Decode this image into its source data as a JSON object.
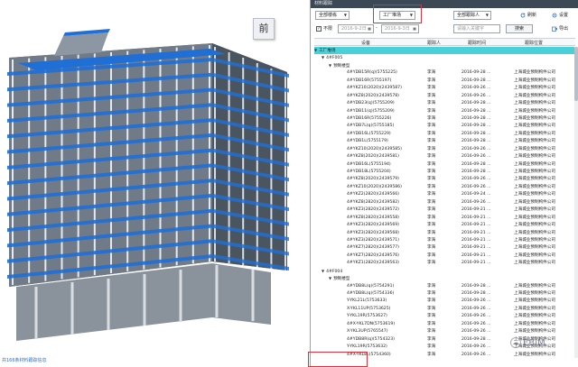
{
  "viewport": {
    "viewcube_label": "前"
  },
  "panel": {
    "title": "材料跟踪",
    "filters": {
      "building_select": "全部楼栋",
      "location_select": "工厂堆场",
      "user_select": "全部跟踪人",
      "refresh_label": "刷新",
      "settings_label": "设置",
      "noframe_label": "不限",
      "date_from_placeholder": "2016-9-2日",
      "date_to_placeholder": "2016-9-3日",
      "keyword_placeholder": "请输入关键字",
      "search_label": "搜索",
      "export_label": "导出"
    },
    "columns": {
      "device": "设备",
      "user": "跟踪人",
      "time": "跟踪时间",
      "location": "跟踪位置"
    },
    "rows": [
      {
        "level": 0,
        "device": "工厂堆场",
        "user": "",
        "time": "",
        "loc": "",
        "hl": true
      },
      {
        "level": 1,
        "device": "4#F005",
        "user": "",
        "time": "",
        "loc": ""
      },
      {
        "level": 2,
        "device": "预制楼型",
        "user": "",
        "time": "",
        "loc": ""
      },
      {
        "level": 3,
        "device": "4#YDB15R(q)(5755225)",
        "user": "李海",
        "time": "2016-09-28 ...",
        "loc": "上海城业预制构件公司"
      },
      {
        "level": 3,
        "device": "4#YDB16R(5755197)",
        "user": "李海",
        "time": "2016-09-28 ...",
        "loc": "上海城业预制构件公司"
      },
      {
        "level": 3,
        "device": "4#YKZ10(2020)(2439587)",
        "user": "李海",
        "time": "2016-09-26 ...",
        "loc": "上海城业预制构件公司"
      },
      {
        "level": 3,
        "device": "4#YKZ8(2020)(2439578)",
        "user": "李海",
        "time": "2016-09-26 ...",
        "loc": "上海城业预制构件公司"
      },
      {
        "level": 3,
        "device": "4#YDB23(q)(5755209)",
        "user": "李海",
        "time": "2016-09-28 ...",
        "loc": "上海城业预制构件公司"
      },
      {
        "level": 3,
        "device": "4#YDB11(q)(5755209)",
        "user": "李海",
        "time": "2016-09-28 ...",
        "loc": "上海城业预制构件公司"
      },
      {
        "level": 3,
        "device": "4#YDB16R(5755226)",
        "user": "李海",
        "time": "2016-09-28 ...",
        "loc": "上海城业预制构件公司"
      },
      {
        "level": 3,
        "device": "4#YDB7L(q)(5755185)",
        "user": "李海",
        "time": "2016-09-28 ...",
        "loc": "上海城业预制构件公司"
      },
      {
        "level": 3,
        "device": "4#YDB16L(5755229)",
        "user": "李海",
        "time": "2016-09-28 ...",
        "loc": "上海城业预制构件公司"
      },
      {
        "level": 3,
        "device": "4#YDB1L(5755179)",
        "user": "李海",
        "time": "2016-09-28 ...",
        "loc": "上海城业预制构件公司"
      },
      {
        "level": 3,
        "device": "4#YKZ10(2020)(2439585)",
        "user": "李海",
        "time": "2016-09-26 ...",
        "loc": "上海城业预制构件公司"
      },
      {
        "level": 3,
        "device": "4#YKZ8(2020)(2439581)",
        "user": "李海",
        "time": "2016-09-26 ...",
        "loc": "上海城业预制构件公司"
      },
      {
        "level": 3,
        "device": "4#YDB16L(5755194)",
        "user": "李海",
        "time": "2016-09-28 ...",
        "loc": "上海城业预制构件公司"
      },
      {
        "level": 3,
        "device": "4#YDB18L(5755204)",
        "user": "李海",
        "time": "2016-09-28 ...",
        "loc": "上海城业预制构件公司"
      },
      {
        "level": 3,
        "device": "4#YKZ8(2020)(2439579)",
        "user": "李海",
        "time": "2016-09-26 ...",
        "loc": "上海城业预制构件公司"
      },
      {
        "level": 3,
        "device": "4#YKZ10(2020)(2439586)",
        "user": "李海",
        "time": "2016-09-26 ...",
        "loc": "上海城业预制构件公司"
      },
      {
        "level": 3,
        "device": "4#YKZ2(2820)(2439566)",
        "user": "李海",
        "time": "2016-09-24 ...",
        "loc": "上海城业预制构件公司"
      },
      {
        "level": 3,
        "device": "4#YKZ8(2820)(2439582)",
        "user": "李海",
        "time": "2016-09-26 ...",
        "loc": "上海城业预制构件公司"
      },
      {
        "level": 3,
        "device": "4#YKZ3(2820)(2439572)",
        "user": "李海",
        "time": "2016-09-21 ...",
        "loc": "上海城业预制构件公司"
      },
      {
        "level": 3,
        "device": "4#YKZ8(2820)(2439558)",
        "user": "李海",
        "time": "2016-09-21 ...",
        "loc": "上海城业预制构件公司"
      },
      {
        "level": 3,
        "device": "4#YKZ3(2820)(2439569)",
        "user": "李海",
        "time": "2016-09-21 ...",
        "loc": "上海城业预制构件公司"
      },
      {
        "level": 3,
        "device": "4#YKZ3(2820)(2439568)",
        "user": "李海",
        "time": "2016-09-21 ...",
        "loc": "上海城业预制构件公司"
      },
      {
        "level": 3,
        "device": "4#YKZ3(2820)(2439571)",
        "user": "李海",
        "time": "2016-09-21 ...",
        "loc": "上海城业预制构件公司"
      },
      {
        "level": 3,
        "device": "4#YKZ7(2820)(2439577)",
        "user": "李海",
        "time": "2016-09-21 ...",
        "loc": "上海城业预制构件公司"
      },
      {
        "level": 3,
        "device": "4#YKZ7(2820)(2439576)",
        "user": "李海",
        "time": "2016-09-21 ...",
        "loc": "上海城业预制构件公司"
      },
      {
        "level": 3,
        "device": "4#YKZ1(2820)(2439563)",
        "user": "李海",
        "time": "2016-09-21 ...",
        "loc": "上海城业预制构件公司"
      },
      {
        "level": 1,
        "device": "4#F004",
        "user": "",
        "time": "",
        "loc": ""
      },
      {
        "level": 2,
        "device": "预制楼型",
        "user": "",
        "time": "",
        "loc": ""
      },
      {
        "level": 3,
        "device": "4#YDB8L(q)(5754291)",
        "user": "李海",
        "time": "2016-09-28 ...",
        "loc": "上海城业预制构件公司"
      },
      {
        "level": 3,
        "device": "4#YDB8L(q)(5754336)",
        "user": "李海",
        "time": "2016-09-28 ...",
        "loc": "上海城业预制构件公司"
      },
      {
        "level": 3,
        "device": "Y-YKL21L(5753633)",
        "user": "李海",
        "time": "2016-09-26 ...",
        "loc": "上海城业预制构件公司"
      },
      {
        "level": 3,
        "device": "X-YKL11UP(5753625)",
        "user": "李海",
        "time": "2016-09-26 ...",
        "loc": "上海城业预制构件公司"
      },
      {
        "level": 3,
        "device": "Y-YKL19R(5753627)",
        "user": "李海",
        "time": "2016-09-26 ...",
        "loc": "上海城业预制构件公司"
      },
      {
        "level": 3,
        "device": "4#X-YKL7DN(5753619)",
        "user": "李海",
        "time": "2016-09-26 ...",
        "loc": "上海城业预制构件公司"
      },
      {
        "level": 3,
        "device": "X-YKL3UP(5765547)",
        "user": "李海",
        "time": "2016-09-26 ...",
        "loc": "上海城业预制构件公司"
      },
      {
        "level": 3,
        "device": "4#YDB8R(q)(5754323)",
        "user": "李海",
        "time": "2016-09-28 ...",
        "loc": "上海城业预制构件公司"
      },
      {
        "level": 3,
        "device": "Y-YKL19R(5753632)",
        "user": "李海",
        "time": "2016-09-26 ...",
        "loc": "上海城业预制构件公司"
      },
      {
        "level": 3,
        "device": "4#X-YKL8L(5754360)",
        "user": "李海",
        "time": "2016-09-26 ...",
        "loc": "上海城业预制构件公司"
      }
    ],
    "status_text": "共166条材料跟踪信息"
  },
  "watermark": {
    "text": "EBIM",
    "icon": "wechat-icon"
  },
  "colors": {
    "titlebar": "#3c4855",
    "highlight_row": "#49d0d8",
    "beam_blue": "#1f6fd6",
    "annotation_red": "#d9333f"
  }
}
